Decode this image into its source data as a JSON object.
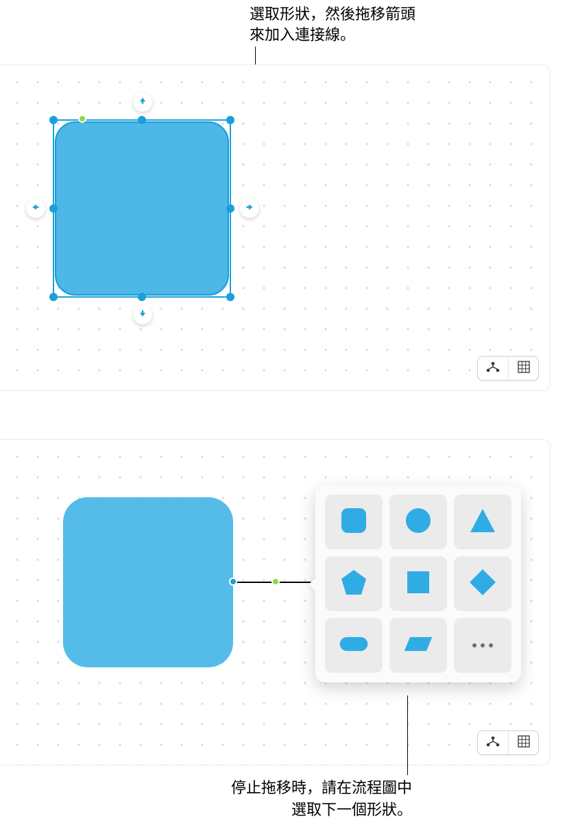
{
  "callouts": {
    "top": "選取形狀，然後拖移箭頭\n來加入連接線。",
    "bottom_line1": "停止拖移時，請在流程圖中",
    "bottom_line2": "選取下一個形狀。"
  },
  "colors": {
    "shape_fill": "#4db7e8",
    "shape_stroke": "#179bd7",
    "selection": "#19a0db",
    "green_handle": "#8ad94a",
    "grid_dot": "#d9d9d9",
    "picker_shape": "#30ace5",
    "cell_bg": "#ebebeb"
  },
  "tools": {
    "connector_mode": "connector-mode-button",
    "grid_toggle": "grid-toggle-button"
  },
  "shape_picker": {
    "items": [
      "rounded-square",
      "circle",
      "triangle",
      "pentagon",
      "square",
      "diamond",
      "rounded-rect",
      "parallelogram",
      "more"
    ]
  }
}
